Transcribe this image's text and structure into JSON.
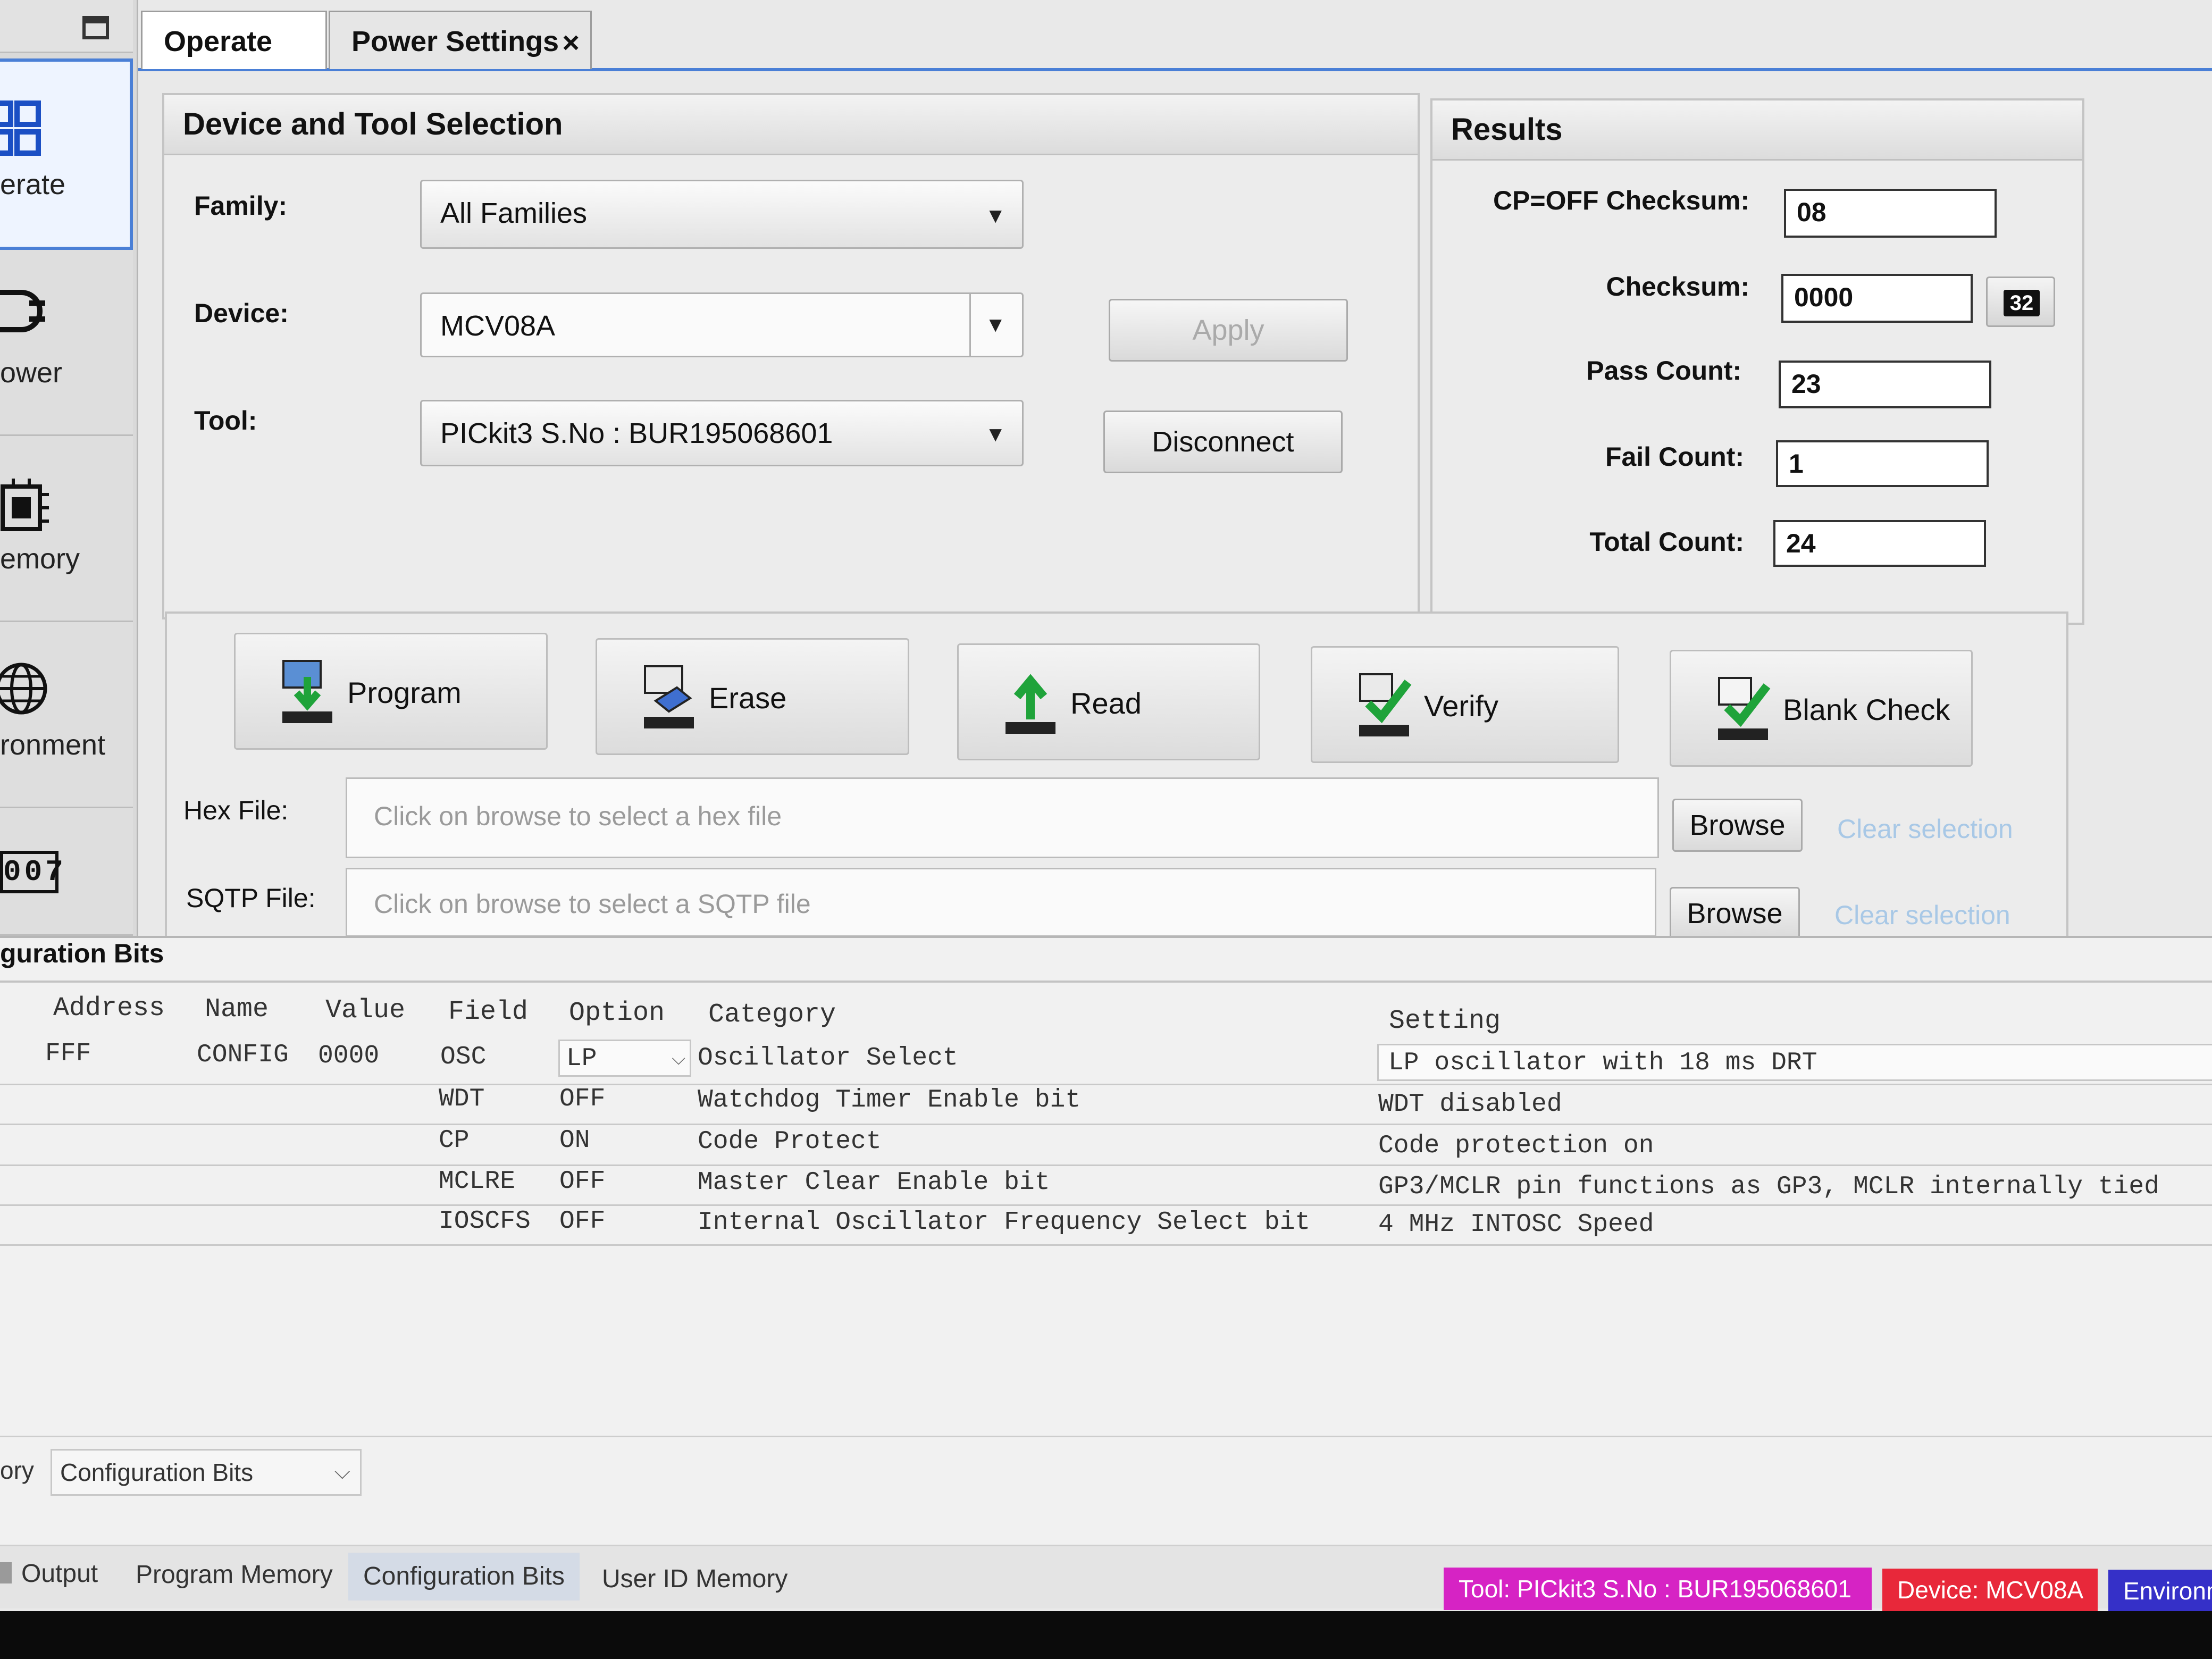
{
  "nav": {
    "items": [
      {
        "label": "erate",
        "icon": "grid-icon"
      },
      {
        "label": "ower",
        "icon": "power-plug-icon"
      },
      {
        "label": "emory",
        "icon": "chip-icon"
      },
      {
        "label": "ronment",
        "icon": "globe-icon"
      },
      {
        "label": "",
        "icon": "counter-icon",
        "digits": "007"
      }
    ]
  },
  "tabs": {
    "operate": "Operate",
    "power_settings": "Power Settings",
    "close": "×"
  },
  "device_selection": {
    "title": "Device and Tool Selection",
    "family_label": "Family:",
    "family_value": "All Families",
    "device_label": "Device:",
    "device_value": "MCV08A",
    "tool_label": "Tool:",
    "tool_value": "PICkit3 S.No : BUR195068601",
    "apply": "Apply",
    "disconnect": "Disconnect"
  },
  "results": {
    "title": "Results",
    "cp_off_checksum_label": "CP=OFF Checksum:",
    "cp_off_checksum": "08",
    "checksum_label": "Checksum:",
    "checksum": "0000",
    "checksum_bits": "32",
    "pass_count_label": "Pass Count:",
    "pass_count": "23",
    "fail_count_label": "Fail Count:",
    "fail_count": "1",
    "total_count_label": "Total Count:",
    "total_count": "24"
  },
  "actions": {
    "program": "Program",
    "erase": "Erase",
    "read": "Read",
    "verify": "Verify",
    "blank_check": "Blank Check"
  },
  "files": {
    "hex_label": "Hex File:",
    "hex_placeholder": "Click on browse to select a hex file",
    "sqtp_label": "SQTP File:",
    "sqtp_placeholder": "Click on browse to select a SQTP file",
    "browse": "Browse",
    "clear_selection": "Clear selection"
  },
  "config": {
    "title": "guration Bits",
    "headers": {
      "address": "Address",
      "name": "Name",
      "value": "Value",
      "field": "Field",
      "option": "Option",
      "category": "Category",
      "setting": "Setting"
    },
    "address": "FFF",
    "name": "CONFIG",
    "value": "0000",
    "rows": [
      {
        "field": "OSC",
        "option": "LP",
        "category": "Oscillator Select",
        "setting": "LP oscillator with 18 ms DRT"
      },
      {
        "field": "WDT",
        "option": "OFF",
        "category": "Watchdog Timer Enable bit",
        "setting": "WDT disabled"
      },
      {
        "field": "CP",
        "option": "ON",
        "category": "Code Protect",
        "setting": "Code protection on"
      },
      {
        "field": "MCLRE",
        "option": "OFF",
        "category": "Master Clear Enable bit",
        "setting": "GP3/MCLR pin functions as GP3, MCLR internally tied"
      },
      {
        "field": "IOSCFS",
        "option": "OFF",
        "category": "Internal Oscillator Frequency Select bit",
        "setting": "4 MHz INTOSC Speed"
      }
    ]
  },
  "memory_selector": {
    "label": "ory",
    "value": "Configuration Bits"
  },
  "bottom_tabs": [
    "Output",
    "Program Memory",
    "Configuration Bits",
    "User ID Memory"
  ],
  "status": {
    "tool": "Tool: PICkit3 S.No : BUR195068601",
    "device": "Device: MCV08A",
    "environment": "Environm",
    "tool_color": "#d623c4",
    "device_color": "#e8283a",
    "environment_color": "#3530c8"
  }
}
